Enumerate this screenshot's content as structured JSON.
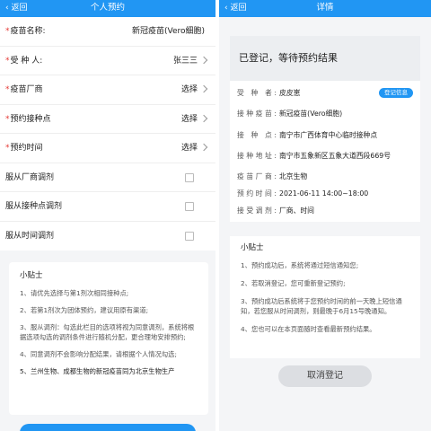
{
  "left": {
    "nav": {
      "back": "返回",
      "title": "个人预约"
    },
    "rows": [
      {
        "label": "疫苗名称:",
        "value": "新冠疫苗(Vero细胞)",
        "required": true
      },
      {
        "label": "受 种 人:",
        "value": "张三三",
        "required": true
      },
      {
        "label": "疫苗厂商",
        "value": "选择",
        "required": true
      },
      {
        "label": "预约接种点",
        "value": "选择",
        "required": true
      },
      {
        "label": "预约时间",
        "value": "选择",
        "required": true
      },
      {
        "label": "服从厂商调剂",
        "value": ""
      },
      {
        "label": "服从接种点调剂",
        "value": ""
      },
      {
        "label": "服从时间调剂",
        "value": ""
      }
    ],
    "tips": {
      "title": "小贴士",
      "items": [
        "1、请优先选择与第1剂次相同接种点;",
        "2、若第1剂次为团体预约，建议用原有渠道;",
        "3、服从调剂：勾选此栏目的选项将视为同意调剂，系统将根据选项勾选的调剂条件进行随机分配，更合理地安排预约;",
        "4、同意调剂不会影响分配结果，请根据个人情况勾选;",
        "5、兰州生物、成都生物的新冠疫苗同为北京生物生产"
      ]
    }
  },
  "right": {
    "nav": {
      "back": "返回",
      "title": "详情"
    },
    "status": "已登记，等待预约结果",
    "badge": "登记信息",
    "details": [
      {
        "label": "受 种 者:",
        "value": "皮皮崽"
      },
      {
        "label": "接种疫苗:",
        "value": "新冠疫苗(Vero细胞)"
      },
      {
        "label": "接 种 点:",
        "value": "南宁市广西体育中心临时接种点"
      },
      {
        "label": "接种地址:",
        "value": "南宁市五象新区五象大道西段669号"
      },
      {
        "label": "疫苗厂商:",
        "value": "北京生物"
      },
      {
        "label": "预约时间:",
        "value": "2021-06-11 14:00~18:00"
      },
      {
        "label": "接受调剂:",
        "value": "厂商、时间"
      }
    ],
    "tips": {
      "title": "小贴士",
      "items": [
        "1、预约成功后，系统将通过短信通知您;",
        "2、若取消登记，您可重新登记预约;",
        "3、预约成功后系统将于您预约时间的前一天晚上短信通知，若您服从时间调剂，则最晚于6月15号晚通知。",
        "4、您也可以在本页面随时查看最新预约结果。"
      ]
    },
    "cancel_label": "取消登记"
  },
  "colors": {
    "primary": "#2196f3",
    "required": "#e53935",
    "background": "#f4f5f7"
  }
}
